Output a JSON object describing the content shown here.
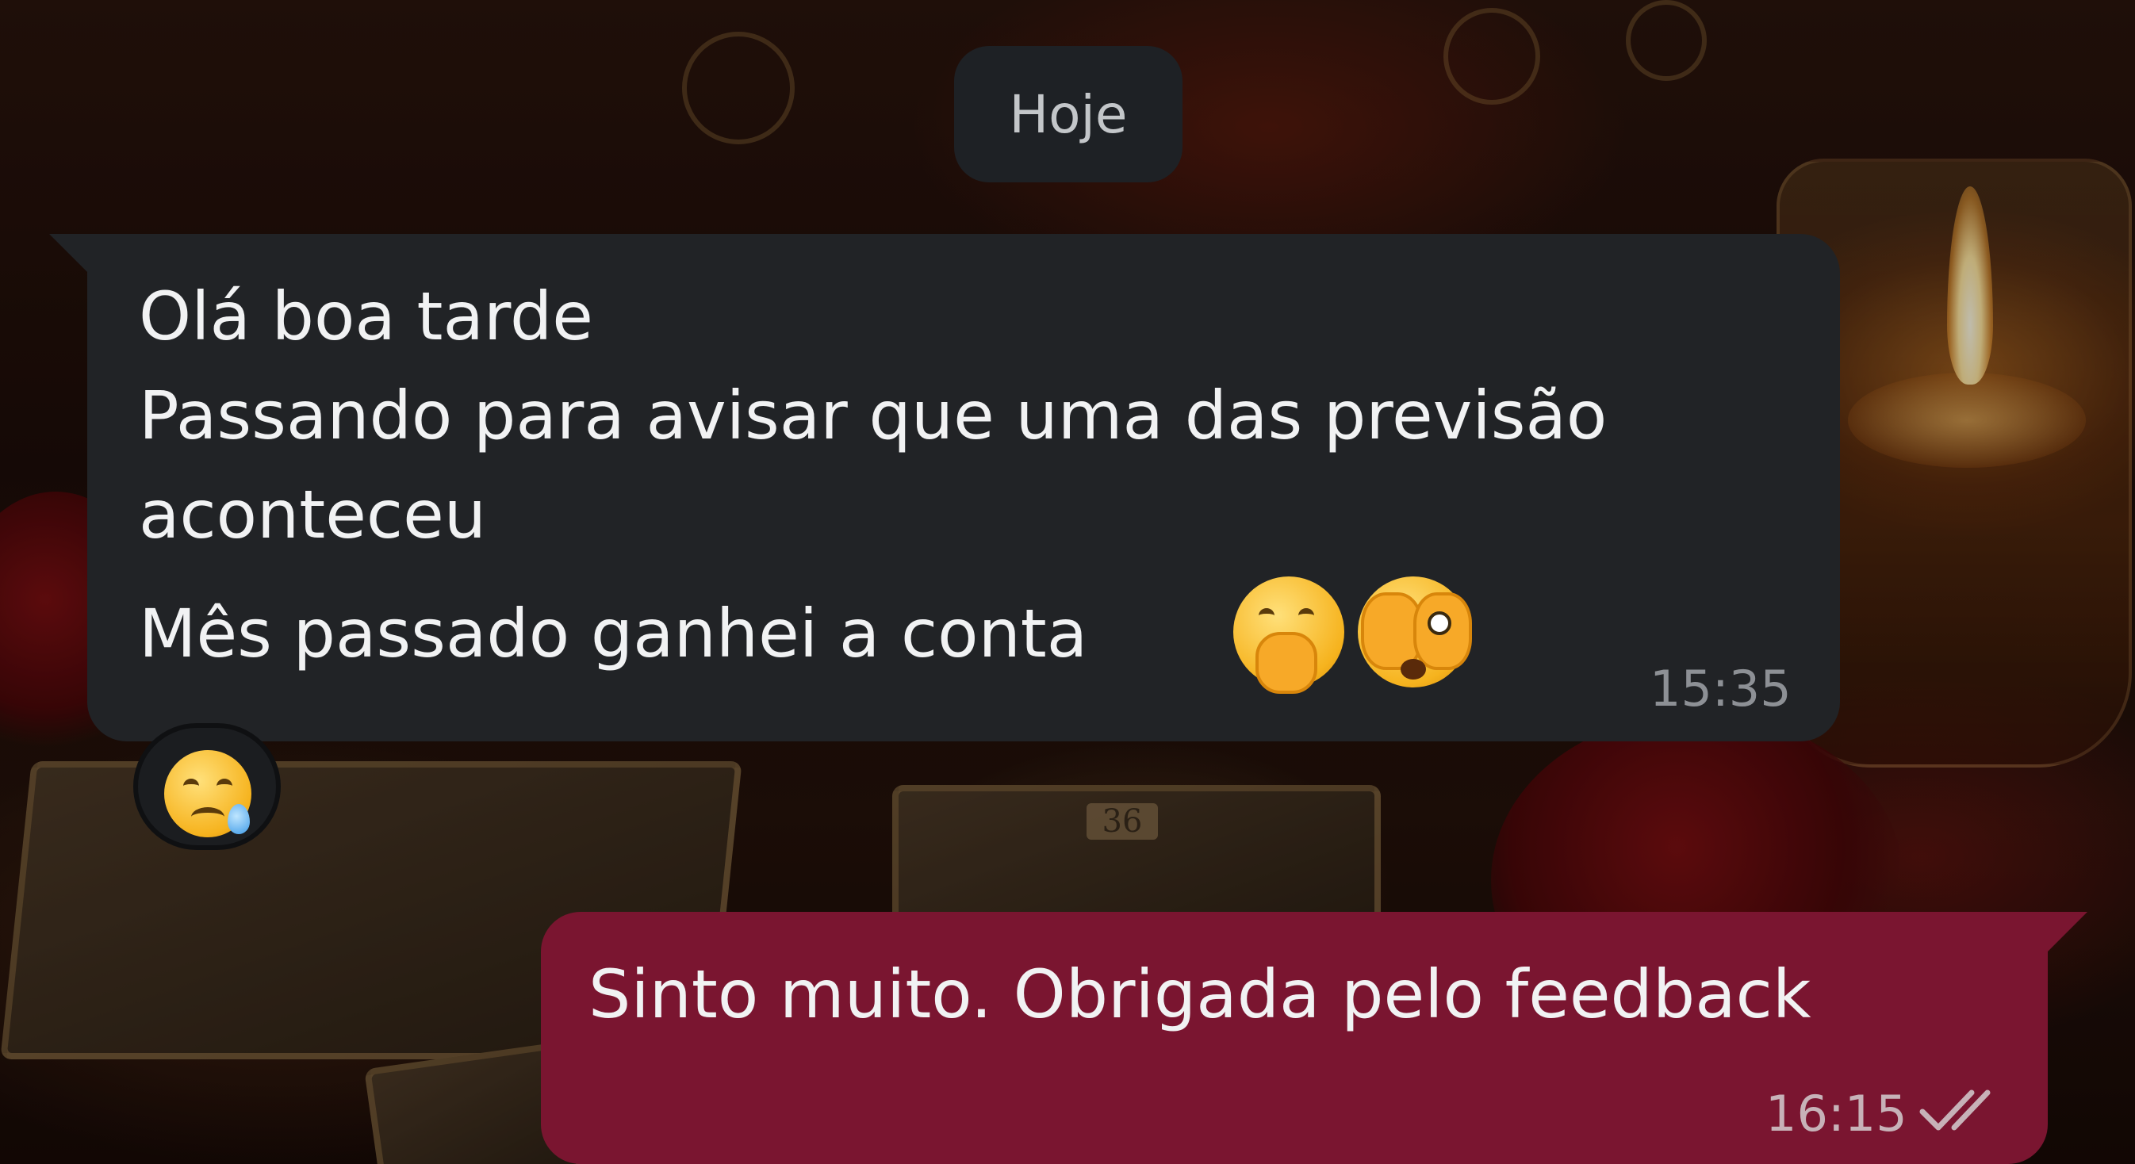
{
  "date_divider": {
    "label": "Hoje"
  },
  "incoming_message": {
    "lines": [
      "Olá boa tarde",
      "Passando para avisar que uma das previsão",
      "aconteceu",
      "Mês passado ganhei a conta"
    ],
    "emojis": [
      "face-with-hand-over-mouth-icon",
      "face-with-peeking-eye-icon"
    ],
    "time": "15:35",
    "reaction": "sad-but-relieved-face-icon"
  },
  "outgoing_message": {
    "text": "Sinto muito. Obrigada pelo feedback",
    "time": "16:15",
    "status": "double-check-icon"
  },
  "colors": {
    "incoming_bubble": "#212326",
    "outgoing_bubble": "#7a1530",
    "date_chip": "#1e2125",
    "text": "#f1f2f3"
  },
  "background": {
    "card_number": "36"
  }
}
